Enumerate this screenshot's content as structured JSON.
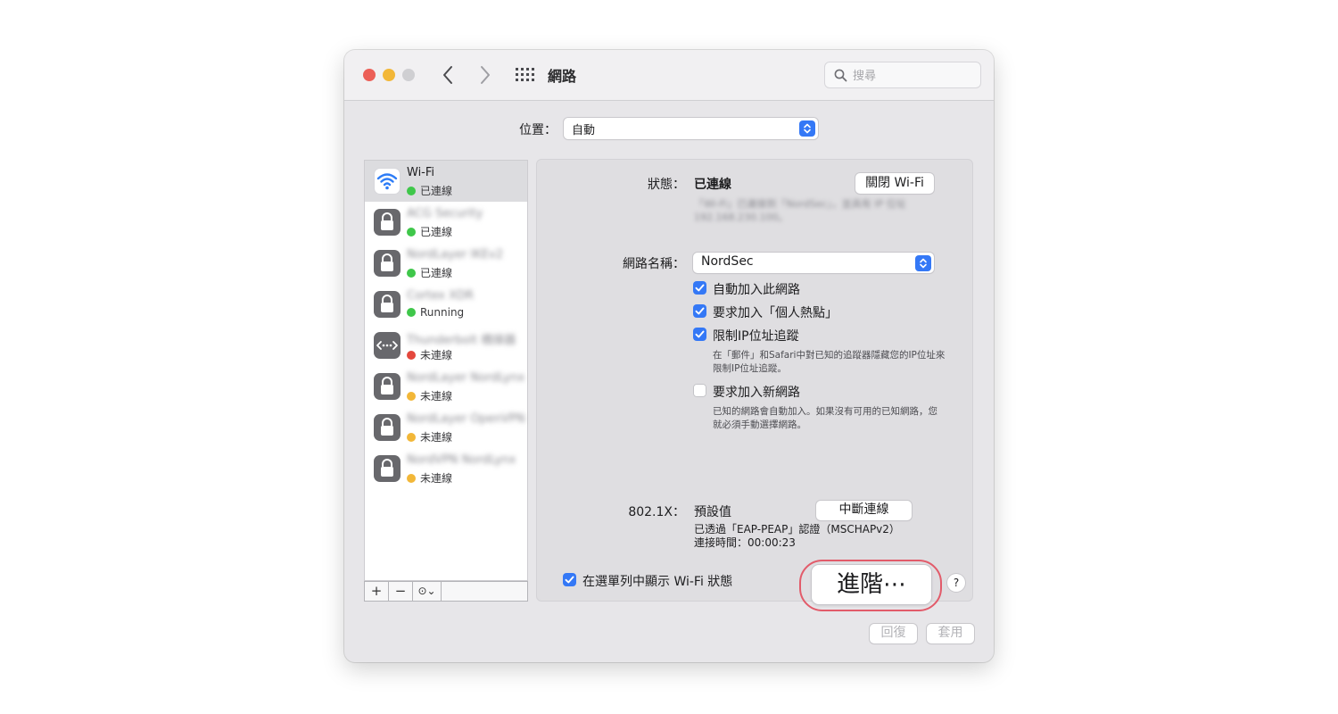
{
  "window": {
    "title": "網路",
    "search_placeholder": "搜尋",
    "icons": [
      "back-chevron-icon",
      "forward-chevron-icon",
      "show-all-grid-icon",
      "search-icon"
    ]
  },
  "location": {
    "label": "位置：",
    "value": "自動"
  },
  "services": [
    {
      "name": "Wi-Fi",
      "status": "已連線",
      "status_color": "#3fc74a",
      "icon": "wifi-icon",
      "selected": true,
      "blurred": false
    },
    {
      "name": "ACG Security",
      "status": "已連線",
      "status_color": "#3fc74a",
      "icon": "lock-icon",
      "selected": false,
      "blurred": true
    },
    {
      "name": "NordLayer IKEv2",
      "status": "已連線",
      "status_color": "#3fc74a",
      "icon": "lock-icon",
      "selected": false,
      "blurred": true
    },
    {
      "name": "Cortex XDR",
      "status": "Running",
      "status_color": "#3fc74a",
      "icon": "lock-icon",
      "selected": false,
      "blurred": true
    },
    {
      "name": "Thunderbolt 橋接器",
      "status": "未連線",
      "status_color": "#e4483d",
      "icon": "thunderbolt-bridge-icon",
      "selected": false,
      "blurred": true
    },
    {
      "name": "NordLayer NordLynx",
      "status": "未連線",
      "status_color": "#f2b738",
      "icon": "lock-icon",
      "selected": false,
      "blurred": true
    },
    {
      "name": "NordLayer OpenVPN",
      "status": "未連線",
      "status_color": "#f2b738",
      "icon": "lock-icon",
      "selected": false,
      "blurred": true
    },
    {
      "name": "NordVPN NordLynx",
      "status": "未連線",
      "status_color": "#f2b738",
      "icon": "lock-icon",
      "selected": false,
      "blurred": true
    }
  ],
  "list_toolbar": {
    "add": "+",
    "remove": "−",
    "more": "⊙⌄"
  },
  "detail": {
    "status_label": "狀態：",
    "status_value": "已連線",
    "turn_off_wifi": "關閉 Wi-Fi",
    "status_desc": "「Wi-Fi」已連接到「NordSec」，並具有 IP 位址 192.168.230.100。",
    "network_name_label": "網路名稱：",
    "network_name_value": "NordSec",
    "options": {
      "auto_join": {
        "label": "自動加入此網路",
        "checked": true
      },
      "ask_hotspot": {
        "label": "要求加入「個人熱點」",
        "checked": true
      },
      "limit_ip": {
        "label": "限制IP位址追蹤",
        "checked": true,
        "note": "在「郵件」和Safari中對已知的追蹤器隱藏您的IP位址來限制IP位址追蹤。"
      },
      "ask_new": {
        "label": "要求加入新網路",
        "checked": false,
        "note": "已知的網路會自動加入。如果沒有可用的已知網路，您就必須手動選擇網路。"
      }
    },
    "x8021_label": "802.1X：",
    "x8021_value": "預設值",
    "disconnect": "中斷連線",
    "x8021_auth": "已透過「EAP-PEAP」認證（MSCHAPv2）",
    "x8021_time": "連接時間：00:00:23",
    "show_in_menubar": {
      "label": "在選單列中顯示 Wi-Fi 狀態",
      "checked": true
    },
    "advanced": "進階⋯",
    "help": "?"
  },
  "footer": {
    "revert": "回復",
    "apply": "套用"
  },
  "colors": {
    "accent": "#3478f6",
    "highlight_ring": "#e25b6a"
  }
}
